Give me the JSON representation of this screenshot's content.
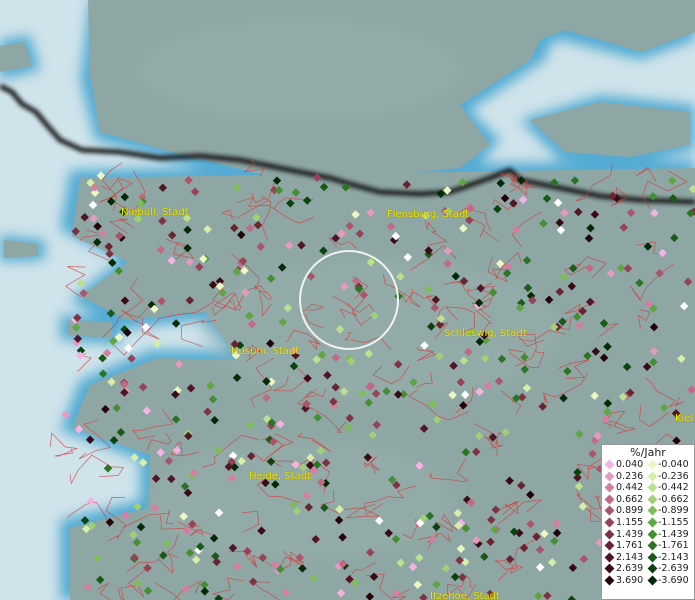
{
  "cities": [
    {
      "name": "Niebüll, Stadt"
    },
    {
      "name": "Flensburg, Stadt"
    },
    {
      "name": "Schleswig, Stadt"
    },
    {
      "name": "Husum, Stadt"
    },
    {
      "name": "Heide, Stadt"
    },
    {
      "name": "Itzehoe, Stadt"
    },
    {
      "name": "Kiel"
    }
  ],
  "legend": {
    "title": "%/Jahr",
    "positive": [
      {
        "label": "0.040",
        "color": "#f4b3e3"
      },
      {
        "label": "0.236",
        "color": "#e79ac0"
      },
      {
        "label": "0.442",
        "color": "#d47fa2"
      },
      {
        "label": "0.662",
        "color": "#c06a85"
      },
      {
        "label": "0.899",
        "color": "#a9566c"
      },
      {
        "label": "1.155",
        "color": "#944456"
      },
      {
        "label": "1.439",
        "color": "#7e3342"
      },
      {
        "label": "1.761",
        "color": "#682431"
      },
      {
        "label": "2.143",
        "color": "#511623"
      },
      {
        "label": "2.639",
        "color": "#3a0b15"
      },
      {
        "label": "3.690",
        "color": "#230208"
      }
    ],
    "negative": [
      {
        "label": "-0.040",
        "color": "#eef7c2"
      },
      {
        "label": "-0.236",
        "color": "#d7edaa"
      },
      {
        "label": "-0.442",
        "color": "#bde08f"
      },
      {
        "label": "-0.662",
        "color": "#9fd076"
      },
      {
        "label": "-0.899",
        "color": "#7fbc5c"
      },
      {
        "label": "-1.155",
        "color": "#5fa544"
      },
      {
        "label": "-1.439",
        "color": "#448e33"
      },
      {
        "label": "-1.761",
        "color": "#2c7425"
      },
      {
        "label": "-2.143",
        "color": "#185a1a"
      },
      {
        "label": "-2.639",
        "color": "#0b4210"
      },
      {
        "label": "-3.690",
        "color": "#032a07"
      }
    ]
  },
  "colors": {
    "water": "#cfe3ea",
    "coast": "#3fa2cf",
    "land": "#8ea7a4",
    "border": "#1a1a1a",
    "district_lines": "#d43a3a",
    "city_label": "#f2e600"
  }
}
